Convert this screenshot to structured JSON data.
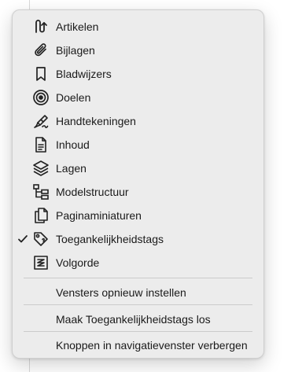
{
  "menu": {
    "items": [
      {
        "label": "Artikelen",
        "icon": "article-icon",
        "checked": false
      },
      {
        "label": "Bijlagen",
        "icon": "paperclip-icon",
        "checked": false
      },
      {
        "label": "Bladwijzers",
        "icon": "bookmark-icon",
        "checked": false
      },
      {
        "label": "Doelen",
        "icon": "target-icon",
        "checked": false
      },
      {
        "label": "Handtekeningen",
        "icon": "signature-pen-icon",
        "checked": false
      },
      {
        "label": "Inhoud",
        "icon": "document-icon",
        "checked": false
      },
      {
        "label": "Lagen",
        "icon": "layers-icon",
        "checked": false
      },
      {
        "label": "Modelstructuur",
        "icon": "model-tree-icon",
        "checked": false
      },
      {
        "label": "Paginaminiaturen",
        "icon": "page-thumbnails-icon",
        "checked": false
      },
      {
        "label": "Toegankelijkheidstags",
        "icon": "tag-icon",
        "checked": true
      },
      {
        "label": "Volgorde",
        "icon": "order-icon",
        "checked": false
      }
    ],
    "actions": [
      {
        "label": "Vensters opnieuw instellen"
      },
      {
        "label": "Maak Toegankelijkheidstags los"
      },
      {
        "label": "Knoppen in navigatievenster verbergen"
      }
    ]
  }
}
